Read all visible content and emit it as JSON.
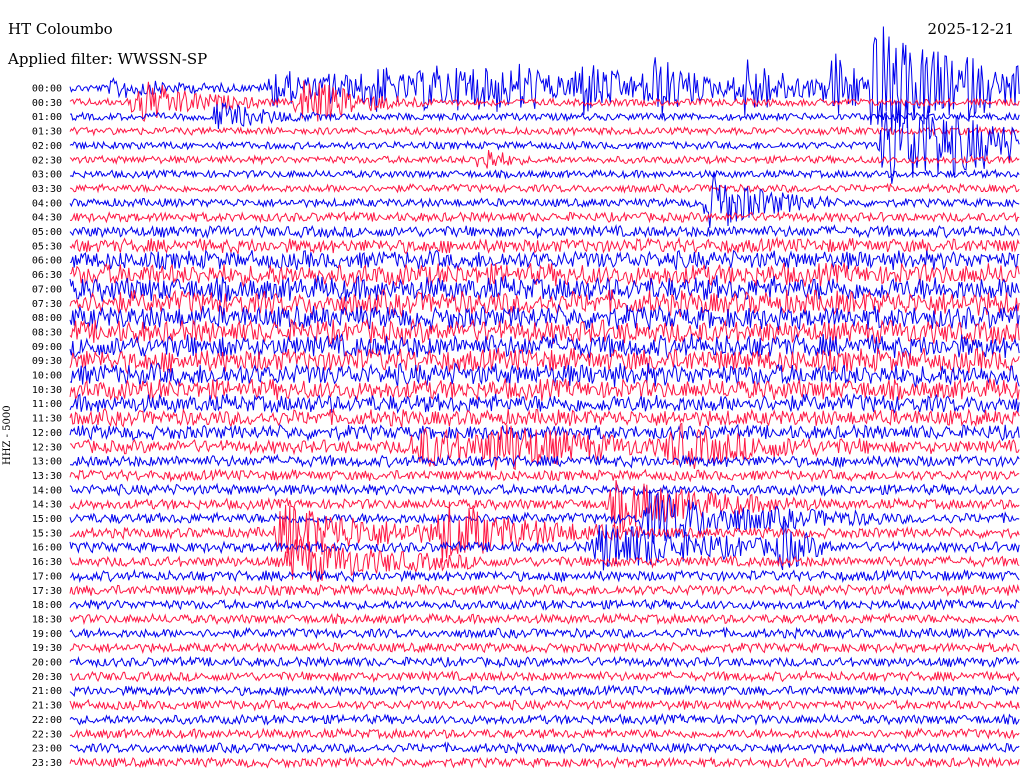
{
  "header": {
    "station": "HT Coloumbo",
    "filter": "Applied filter: WWSSN-SP",
    "date": "2025-12-21",
    "channel": "HHZ - 5000"
  },
  "colors": {
    "trace_a": "#0000ee",
    "trace_b": "#ff1744",
    "background": "#ffffff",
    "text": "#000000"
  },
  "chart_data": {
    "type": "line",
    "title": "HT Coloumbo",
    "subtitle": "Applied filter: WWSSN-SP",
    "ylabel": "HHZ - 5000",
    "row_labels": [
      "00:00",
      "00:30",
      "01:00",
      "01:30",
      "02:00",
      "02:30",
      "03:00",
      "03:30",
      "04:00",
      "04:30",
      "05:00",
      "05:30",
      "06:00",
      "06:30",
      "07:00",
      "07:30",
      "08:00",
      "08:30",
      "09:00",
      "09:30",
      "10:00",
      "10:30",
      "11:00",
      "11:30",
      "12:00",
      "12:30",
      "13:00",
      "13:30",
      "14:00",
      "14:30",
      "15:00",
      "15:30",
      "16:00",
      "16:30",
      "17:00",
      "17:30",
      "18:00",
      "18:30",
      "19:00",
      "19:30",
      "20:00",
      "20:30",
      "21:00",
      "21:30",
      "22:00",
      "22:30",
      "23:00",
      "23:30"
    ],
    "row_minutes": 30,
    "series_colors_alternating": [
      "blue",
      "red"
    ],
    "noise_level_by_row": [
      0.3,
      0.3,
      0.3,
      0.3,
      0.3,
      0.3,
      0.3,
      0.35,
      0.4,
      0.5,
      0.7,
      1.0,
      1.4,
      1.8,
      2.0,
      2.0,
      1.9,
      1.9,
      1.9,
      1.9,
      1.8,
      1.6,
      1.4,
      1.2,
      1.0,
      0.9,
      0.7,
      0.6,
      0.6,
      0.6,
      0.6,
      0.6,
      0.6,
      0.6,
      0.6,
      0.6,
      0.5,
      0.5,
      0.5,
      0.5,
      0.5,
      0.5,
      0.5,
      0.5,
      0.5,
      0.5,
      0.5,
      0.5
    ],
    "events": [
      {
        "row": 0,
        "minute": 1.5,
        "amp": 0.4,
        "dur": 1.5
      },
      {
        "row": 0,
        "minute": 6.5,
        "amp": 0.9,
        "dur": 1.2
      },
      {
        "row": 0,
        "minute": 8.3,
        "amp": 0.6,
        "dur": 0.8
      },
      {
        "row": 0,
        "minute": 9.5,
        "amp": 1.0,
        "dur": 1.5
      },
      {
        "row": 0,
        "minute": 11.3,
        "amp": 0.8,
        "dur": 1.5
      },
      {
        "row": 0,
        "minute": 12.5,
        "amp": 0.7,
        "dur": 1.0
      },
      {
        "row": 0,
        "minute": 13.5,
        "amp": 0.6,
        "dur": 1.0
      },
      {
        "row": 0,
        "minute": 14.3,
        "amp": 0.7,
        "dur": 1.2
      },
      {
        "row": 0,
        "minute": 16.1,
        "amp": 1.2,
        "dur": 1.5
      },
      {
        "row": 0,
        "minute": 18.4,
        "amp": 1.2,
        "dur": 1.5
      },
      {
        "row": 0,
        "minute": 21.3,
        "amp": 1.2,
        "dur": 1.5
      },
      {
        "row": 0,
        "minute": 24.1,
        "amp": 1.5,
        "dur": 1.0
      },
      {
        "row": 0,
        "minute": 25.5,
        "amp": 2.6,
        "dur": 2.0
      },
      {
        "row": 0,
        "minute": 27.1,
        "amp": 0.8,
        "dur": 1.0
      },
      {
        "row": 0,
        "minute": 28.4,
        "amp": 0.6,
        "dur": 1.0
      },
      {
        "row": 0,
        "minute": 30.0,
        "amp": 0.7,
        "dur": 1.0
      },
      {
        "row": 0,
        "minute": 31.1,
        "amp": 0.7,
        "dur": 1.0
      },
      {
        "row": 0,
        "minute": 33.3,
        "amp": 1.0,
        "dur": 1.5
      },
      {
        "row": 0,
        "minute": 36.2,
        "amp": 1.0,
        "dur": 1.5
      },
      {
        "row": 1,
        "minute": 2.2,
        "amp": 1.0,
        "dur": 1.5
      },
      {
        "row": 1,
        "minute": 7.4,
        "amp": 1.1,
        "dur": 1.5
      },
      {
        "row": 1,
        "minute": 34.3,
        "amp": 1.2,
        "dur": 1.5
      },
      {
        "row": 2,
        "minute": 4.7,
        "amp": 0.6,
        "dur": 1.2
      },
      {
        "row": 4,
        "minute": 25.9,
        "amp": 2.5,
        "dur": 3.0
      },
      {
        "row": 5,
        "minute": 13.1,
        "amp": 0.6,
        "dur": 0.5
      },
      {
        "row": 8,
        "minute": 20.3,
        "amp": 1.3,
        "dur": 1.5
      },
      {
        "row": 25,
        "minute": 11.0,
        "amp": 0.8,
        "dur": 2.5
      },
      {
        "row": 25,
        "minute": 13.5,
        "amp": 0.8,
        "dur": 2.5
      },
      {
        "row": 25,
        "minute": 19.1,
        "amp": 0.8,
        "dur": 2.5
      },
      {
        "row": 27,
        "minute": 32.2,
        "amp": 1.2,
        "dur": 3.0
      },
      {
        "row": 28,
        "minute": 31.5,
        "amp": 1.0,
        "dur": 3.0
      },
      {
        "row": 29,
        "minute": 17.3,
        "amp": 1.1,
        "dur": 2.5
      },
      {
        "row": 30,
        "minute": 18.3,
        "amp": 1.1,
        "dur": 3.0
      },
      {
        "row": 30,
        "minute": 36.0,
        "amp": 1.0,
        "dur": 1.5
      },
      {
        "row": 31,
        "minute": 6.8,
        "amp": 1.3,
        "dur": 2.5
      },
      {
        "row": 31,
        "minute": 11.8,
        "amp": 1.2,
        "dur": 2.5
      },
      {
        "row": 32,
        "minute": 16.8,
        "amp": 1.1,
        "dur": 3.0
      },
      {
        "row": 32,
        "minute": 22.6,
        "amp": 1.0,
        "dur": 0.5
      },
      {
        "row": 33,
        "minute": 7.1,
        "amp": 1.0,
        "dur": 2.5
      },
      {
        "row": 35,
        "minute": 35.5,
        "amp": 1.1,
        "dur": 1.5
      }
    ]
  }
}
